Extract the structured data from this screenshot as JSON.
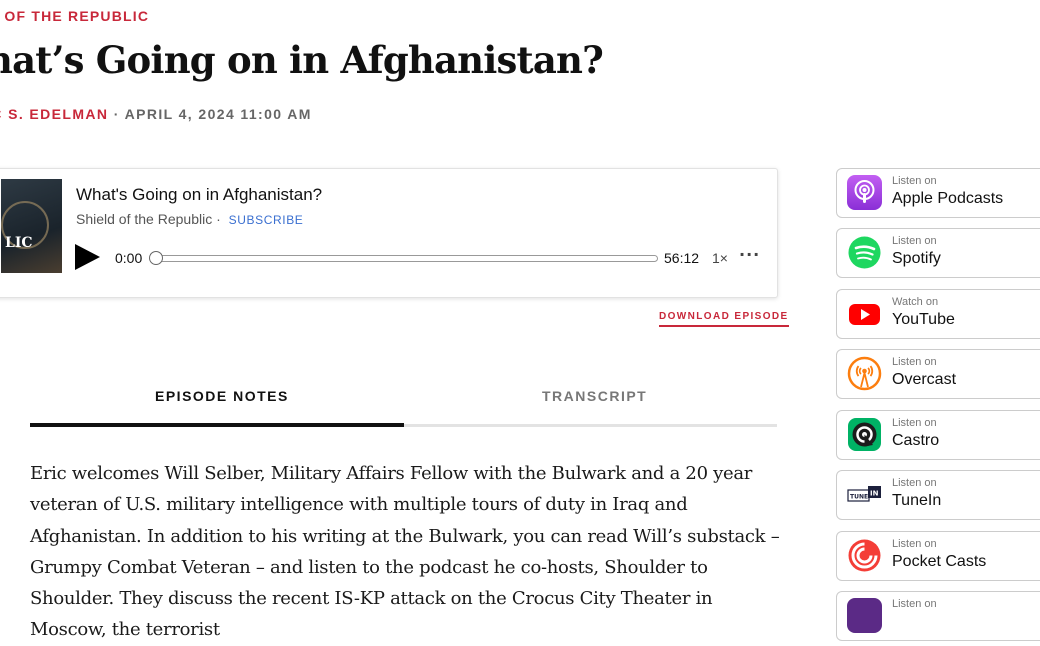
{
  "header": {
    "kicker": "D OF THE REPUBLIC",
    "title": "hat’s Going on in Afghanistan?",
    "author": "IC S. EDELMAN",
    "separator": "·",
    "date": "APRIL 4, 2024 11:00 AM"
  },
  "player": {
    "episode_title": "What's Going on in Afghanistan?",
    "show_name": "Shield of the Republic",
    "show_sep": "·",
    "subscribe_label": "SUBSCRIBE",
    "current_time": "0:00",
    "total_time": "56:12",
    "speed": "1×",
    "more_label": "···",
    "progress": 0,
    "cover_text": "LIC"
  },
  "download_label": "DOWNLOAD EPISODE",
  "tabs": {
    "notes": "EPISODE NOTES",
    "transcript": "TRANSCRIPT",
    "active": "notes"
  },
  "episode_notes": "Eric welcomes Will Selber, Military Affairs Fellow with the Bulwark and a 20 year veteran of U.S. military intelligence with multiple tours of duty in Iraq and Afghanistan. In addition to his writing at the Bulwark, you can read Will’s substack – Grumpy Combat Veteran – and listen to the podcast he co-hosts, Shoulder to Shoulder. They discuss the recent IS-KP attack on the Crocus City Theater in Moscow, the terrorist",
  "platforms": [
    {
      "prefix": "Listen on",
      "name": "Apple Podcasts",
      "icon": "apple-podcasts-icon",
      "color": "#a43ce4"
    },
    {
      "prefix": "Listen on",
      "name": "Spotify",
      "icon": "spotify-icon",
      "color": "#1ed760"
    },
    {
      "prefix": "Watch on",
      "name": "YouTube",
      "icon": "youtube-icon",
      "color": "#ff0000"
    },
    {
      "prefix": "Listen on",
      "name": "Overcast",
      "icon": "overcast-icon",
      "color": "#fc7e0f"
    },
    {
      "prefix": "Listen on",
      "name": "Castro",
      "icon": "castro-icon",
      "color": "#00b265"
    },
    {
      "prefix": "Listen on",
      "name": "TuneIn",
      "icon": "tunein-icon",
      "color": "#1c203c"
    },
    {
      "prefix": "Listen on",
      "name": "Pocket Casts",
      "icon": "pocket-casts-icon",
      "color": "#f43e37"
    },
    {
      "prefix": "Listen on",
      "name": "",
      "icon": "podcast-app-icon",
      "color": "#5b2a86"
    }
  ]
}
